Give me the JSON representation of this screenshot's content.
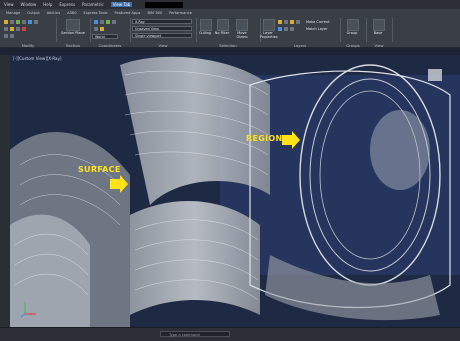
{
  "titlebar": {
    "items": [
      "View",
      "Window",
      "Help",
      "Express",
      "Parametric",
      "View Tab"
    ],
    "selected_index": 5
  },
  "menubar": {
    "items": [
      "Manage",
      "Output",
      "Add-ins",
      "A360",
      "Express Tools",
      "Featured Apps",
      "BIM 360",
      "Performance"
    ]
  },
  "ribbon": {
    "view_label": "X-Ray",
    "visual_style": "Unsaved View",
    "world_label": "World",
    "viewport_config": "Single viewport",
    "filter_label": "No Filter",
    "section_plane_label": "Section Plane",
    "culling_label": "Culling",
    "gizmo_label": "Move Gizmo",
    "layer_props_label": "Layer Properties",
    "make_current_label": "Make Current",
    "match_layer_label": "Match Layer",
    "group_label": "Group",
    "base_label": "Base",
    "panels": [
      "Modify",
      "Section",
      "Coordinates",
      "View",
      "Selection",
      "Layers",
      "Groups",
      "View"
    ]
  },
  "viewport": {
    "label": "[-][Custom View][X-Ray]"
  },
  "annotations": {
    "surface": "SURFACE",
    "region": "REGION"
  },
  "status": {
    "command_placeholder": "Type a command"
  },
  "colors": {
    "callout": "#ffe21a",
    "viewport_bg": "#1f2a45"
  }
}
